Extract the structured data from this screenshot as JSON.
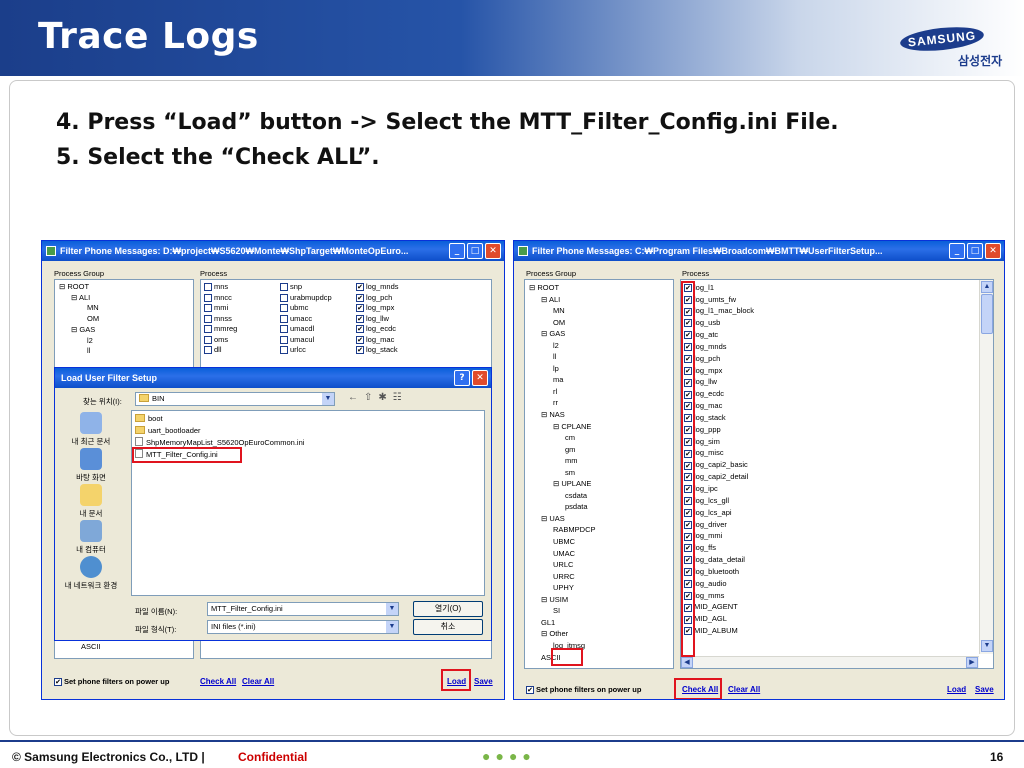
{
  "slide": {
    "title": "Trace Logs",
    "logo_text": "SAMSUNG",
    "logo_sub": "삼성전자",
    "steps": [
      "4. Press “Load” button -> Select the MTT_Filter_Config.ini   File.",
      "5. Select the “Check ALL”."
    ],
    "footer": {
      "copyright": "© Samsung Electronics Co., LTD  |",
      "confidential": "Confidential",
      "page": "16"
    }
  },
  "left_window": {
    "title": "Filter Phone Messages: D:₩project₩S5620₩Monte₩ShpTarget₩MonteOpEuro...",
    "process_group_label": "Process Group",
    "process_label": "Process",
    "tree": [
      "⊟ ROOT",
      "⊟ ALI",
      "MN",
      "OM",
      "⊟ GAS",
      "l2",
      "ll"
    ],
    "tree_bottom": "ASCII",
    "process_cols": [
      [
        {
          "label": "mns",
          "checked": false
        },
        {
          "label": "mncc",
          "checked": false
        },
        {
          "label": "mmi",
          "checked": false
        },
        {
          "label": "mnss",
          "checked": false
        },
        {
          "label": "mmreg",
          "checked": false
        },
        {
          "label": "oms",
          "checked": false
        },
        {
          "label": "dll",
          "checked": false
        }
      ],
      [
        {
          "label": "snp",
          "checked": false
        },
        {
          "label": "urabmupdcp",
          "checked": false
        },
        {
          "label": "ubmc",
          "checked": false
        },
        {
          "label": "umacc",
          "checked": false
        },
        {
          "label": "umacdl",
          "checked": false
        },
        {
          "label": "umacul",
          "checked": false
        },
        {
          "label": "urlcc",
          "checked": false
        }
      ],
      [
        {
          "label": "log_mnds",
          "checked": true
        },
        {
          "label": "log_pch",
          "checked": true
        },
        {
          "label": "log_mpx",
          "checked": true
        },
        {
          "label": "log_llw",
          "checked": true
        },
        {
          "label": "log_ecdc",
          "checked": true
        },
        {
          "label": "log_mac",
          "checked": true
        },
        {
          "label": "log_stack",
          "checked": true
        }
      ]
    ],
    "footer_checkbox": "Set phone filters on power up",
    "check_all": "Check All",
    "clear_all": "Clear All",
    "load": "Load",
    "save": "Save"
  },
  "dialog": {
    "title": "Load User Filter Setup",
    "look_in_label": "찾는 위치(I):",
    "look_in_value": "BIN",
    "places": [
      "내 최근 문서",
      "바탕 화면",
      "내 문서",
      "내 컴퓨터",
      "내 네트워크 환경"
    ],
    "files": [
      {
        "name": "boot",
        "type": "folder"
      },
      {
        "name": "uart_bootloader",
        "type": "folder"
      },
      {
        "name": "ShpMemoryMapList_S5620OpEuroCommon.ini",
        "type": "file"
      },
      {
        "name": "MTT_Filter_Config.ini",
        "type": "file"
      }
    ],
    "filename_label": "파일 이름(N):",
    "filename_value": "MTT_Filter_Config.ini",
    "filetype_label": "파일 형식(T):",
    "filetype_value": "INI files (*.ini)",
    "open_button": "열기(O)",
    "cancel_button": "취소"
  },
  "right_window": {
    "title": "Filter Phone Messages: C:₩Program Files₩Broadcom₩BMTT₩UserFilterSetup...",
    "process_group_label": "Process Group",
    "process_label": "Process",
    "tree": [
      "⊟ ROOT",
      "⊟ ALI",
      "MN",
      "OM",
      "⊟ GAS",
      "l2",
      "ll",
      "lp",
      "ma",
      "rl",
      "rr",
      "⊟ NAS",
      "⊟ CPLANE",
      "cm",
      "gm",
      "mm",
      "sm",
      "⊟ UPLANE",
      "csdata",
      "psdata",
      "⊟ UAS",
      "RABMPDCP",
      "UBMC",
      "UMAC",
      "URLC",
      "URRC",
      "UPHY",
      "⊟ USIM",
      "SI",
      "GL1",
      "⊟ Other",
      "log_itmsg",
      "ASCII"
    ],
    "process": [
      "log_l1",
      "log_umts_fw",
      "log_l1_mac_block",
      "log_usb",
      "log_atc",
      "log_mnds",
      "log_pch",
      "log_mpx",
      "log_llw",
      "log_ecdc",
      "log_mac",
      "log_stack",
      "log_ppp",
      "log_sim",
      "log_misc",
      "log_capi2_basic",
      "log_capi2_detail",
      "log_ipc",
      "log_lcs_gll",
      "log_lcs_api",
      "log_driver",
      "log_mmi",
      "log_ffs",
      "log_data_detail",
      "log_bluetooth",
      "log_audio",
      "log_mms",
      "MID_AGENT",
      "MID_AGL",
      "MID_ALBUM"
    ],
    "footer_checkbox": "Set phone filters on power up",
    "check_all": "Check All",
    "clear_all": "Clear All",
    "load": "Load",
    "save": "Save"
  }
}
